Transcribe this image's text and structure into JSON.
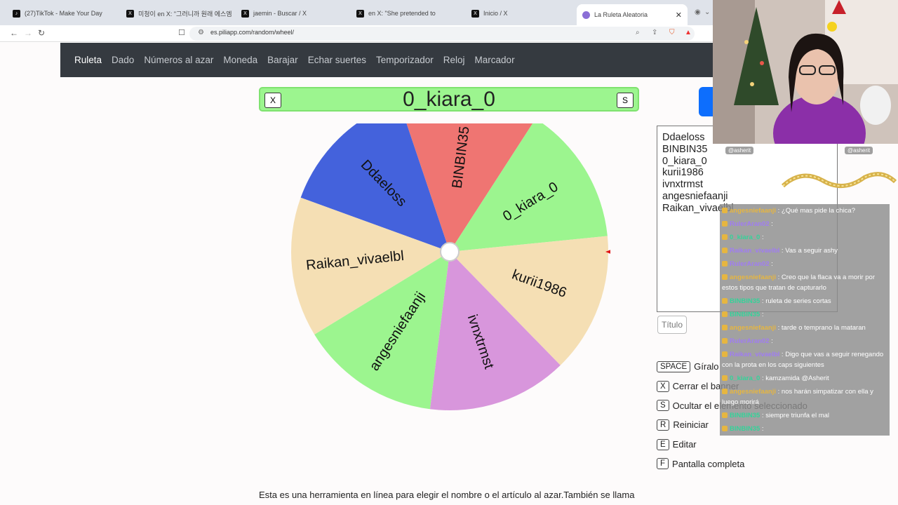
{
  "browser": {
    "tabs": [
      {
        "label": "(27)TikTok - Make Your Day",
        "icon": "tiktok-icon"
      },
      {
        "label": "미청이 en X: \"그러니까 원래 에스엠",
        "icon": "x-icon"
      },
      {
        "label": "jaemin - Buscar / X",
        "icon": "x-icon"
      },
      {
        "label": "en X: \"She pretended to",
        "icon": "x-icon"
      },
      {
        "label": "Inicio / X",
        "icon": "x-icon"
      },
      {
        "label": "La Ruleta Aleatoria",
        "icon": "piliapp-icon"
      }
    ],
    "url": "es.piliapp.com/random/wheel/"
  },
  "site_nav": [
    "Ruleta",
    "Dado",
    "Números al azar",
    "Moneda",
    "Barajar",
    "Echar suertes",
    "Temporizador",
    "Reloj",
    "Marcador"
  ],
  "banner": {
    "winner": "0_kiara_0",
    "close_key": "X",
    "hide_key": "S",
    "color": "#9cf58f"
  },
  "wheel": {
    "segments": [
      {
        "label": "Ddaeloss",
        "color": "#4462dc"
      },
      {
        "label": "BINBIN35",
        "color": "#ef7572"
      },
      {
        "label": "0_kiara_0",
        "color": "#9cf58f"
      },
      {
        "label": "kurii1986",
        "color": "#f5dfb4"
      },
      {
        "label": "ivnxtrmst",
        "color": "#d896dc"
      },
      {
        "label": "angesniefaanji",
        "color": "#9cf58f"
      },
      {
        "label": "Raikan_vivaelbl",
        "color": "#f5dfb4"
      }
    ],
    "pointer_color": "#e01515"
  },
  "names_list": [
    "Ddaeloss",
    "BINBIN35",
    "0_kiara_0",
    "kurii1986",
    "ivnxtrmst",
    "angesniefaanji",
    "Raikan_vivaelbl"
  ],
  "title_placeholder": "Título",
  "shortcuts": [
    {
      "key": "SPACE",
      "label": "Gíralo"
    },
    {
      "key": "X",
      "label": "Cerrar el banner"
    },
    {
      "key": "S",
      "label": "Ocultar el elemento seleccionado"
    },
    {
      "key": "R",
      "label": "Reiniciar"
    },
    {
      "key": "E",
      "label": "Editar"
    },
    {
      "key": "F",
      "label": "Pantalla completa"
    }
  ],
  "description": "Esta es una herramienta en línea para elegir el nombre o el artículo al azar.También se llama",
  "chat": {
    "header_tags": [
      "@asherit",
      "@asherit"
    ],
    "messages": [
      {
        "user": "angesniefaanji",
        "text": ": ¿Qué mas pide la chica?",
        "color": "#e6b640"
      },
      {
        "user": "RulerAran02",
        "text": ":",
        "color": "#a07cf2"
      },
      {
        "user": "0_kiara_0",
        "text": ":",
        "color": "#34d399"
      },
      {
        "user": "Raikan_vivaelbl",
        "text": ": Vas a seguir ashy",
        "color": "#a07cf2"
      },
      {
        "user": "RulerAran02",
        "text": ":",
        "color": "#a07cf2"
      },
      {
        "user": "angesniefaanji",
        "text": ": Creo que la flaca va a morir por estos tipos que tratan de capturarlo",
        "color": "#e6b640"
      },
      {
        "user": "BINBIN35",
        "text": ": ruleta de series cortas",
        "color": "#34d399"
      },
      {
        "user": "BINBIN35",
        "text": ":",
        "color": "#34d399"
      },
      {
        "user": "angesniefaanji",
        "text": ": tarde o temprano la mataran",
        "color": "#e6b640"
      },
      {
        "user": "RulerAran02",
        "text": ":",
        "color": "#a07cf2"
      },
      {
        "user": "Raikan_vivaelbl",
        "text": ": Digo que vas a seguir renegando con la prota en los caps siguientes",
        "color": "#a07cf2"
      },
      {
        "user": "0_kiara_0",
        "text": ": kamzamida @Asherit",
        "color": "#34d399"
      },
      {
        "user": "angesniefaanji",
        "text": ": nos harán simpatizar con ella y luego morirá",
        "color": "#e6b640"
      },
      {
        "user": "BINBIN35",
        "text": ": siempre triunfa el mal",
        "color": "#34d399"
      },
      {
        "user": "BINBIN35",
        "text": ":",
        "color": "#34d399"
      }
    ]
  }
}
